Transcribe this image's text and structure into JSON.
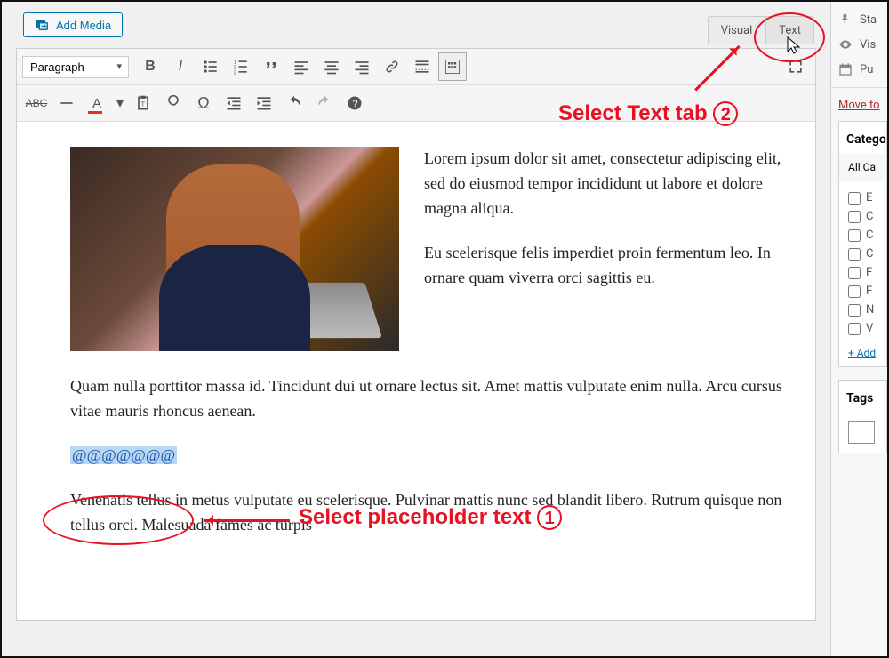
{
  "toolbar": {
    "add_media": "Add Media",
    "format_dropdown": "Paragraph"
  },
  "tabs": {
    "visual": "Visual",
    "text": "Text"
  },
  "content": {
    "para1": "Lorem ipsum dolor sit amet, consectetur adipiscing elit, sed do eiusmod tempor incididunt ut labore et dolore magna aliqua.",
    "para2": "Eu scelerisque felis imperdiet proin fermentum leo. In ornare quam viverra orci sagittis eu.",
    "para3": "Quam nulla porttitor massa id. Tincidunt dui ut ornare lectus sit. Amet mattis vulputate enim nulla. Arcu cursus vitae mauris rhoncus aenean.",
    "placeholder": "@@@@@@@",
    "para4": "Venenatis tellus in metus vulputate eu scelerisque. Pulvinar mattis nunc sed blandit libero. Rutrum quisque non tellus orci. Malesuada fames ac turpis"
  },
  "annotations": {
    "select_text_tab": "Select Text tab",
    "num2": "2",
    "select_placeholder": "Select placeholder text",
    "num1": "1"
  },
  "sidebar": {
    "status": "Sta",
    "visibility": "Vis",
    "publish": "Pu",
    "move_trash": "Move to",
    "categories_title": "Catego",
    "all_cat_tab": "All Ca",
    "cat_items": [
      "E",
      "C",
      "C",
      "C",
      "F",
      "F",
      "N",
      "V"
    ],
    "add_new": "+ Add",
    "tags_title": "Tags"
  }
}
